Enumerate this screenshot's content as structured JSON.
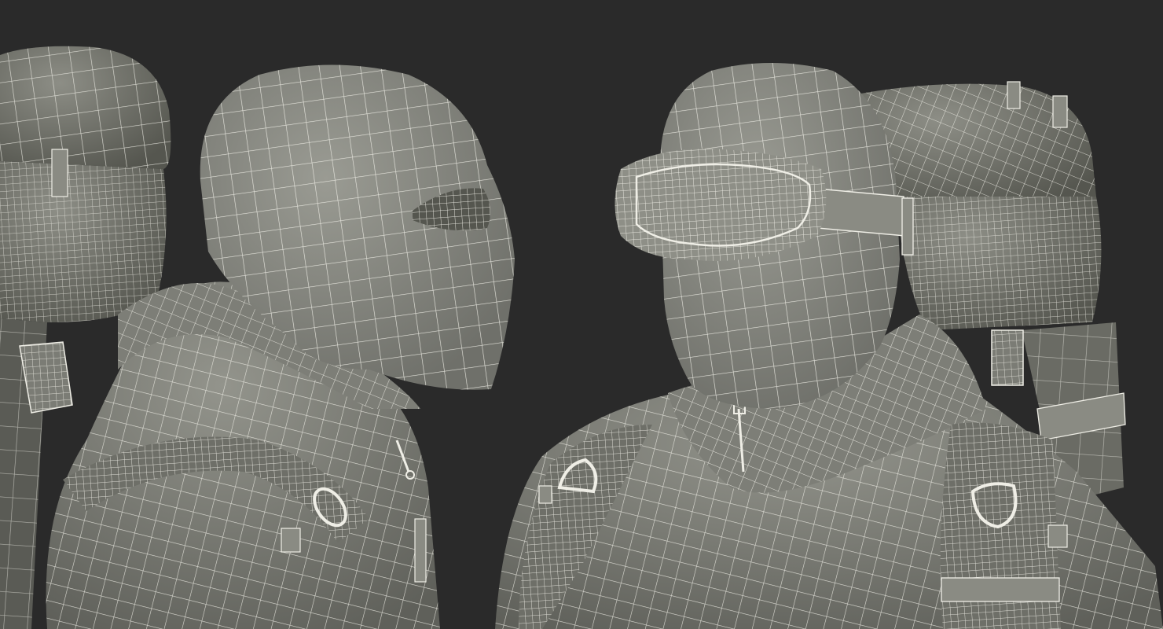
{
  "colors": {
    "background": "#2a2a2a",
    "surface": "#8e8f87",
    "surface_shadow": "#6c6d66",
    "surface_dark": "#4e4f4a",
    "wire": "#efeee6"
  },
  "figures": [
    {
      "name": "left-climber",
      "view": "right-profile",
      "parts": [
        "hood-balaclava",
        "jacket",
        "backpack",
        "shoulder-strap",
        "d-ring",
        "buckle",
        "zipper-pull"
      ]
    },
    {
      "name": "right-climber",
      "view": "three-quarter-front",
      "parts": [
        "hood-balaclava",
        "goggles",
        "goggle-strap",
        "jacket",
        "collar-zipper",
        "backpack",
        "shoulder-straps",
        "d-rings",
        "buckle"
      ]
    }
  ]
}
